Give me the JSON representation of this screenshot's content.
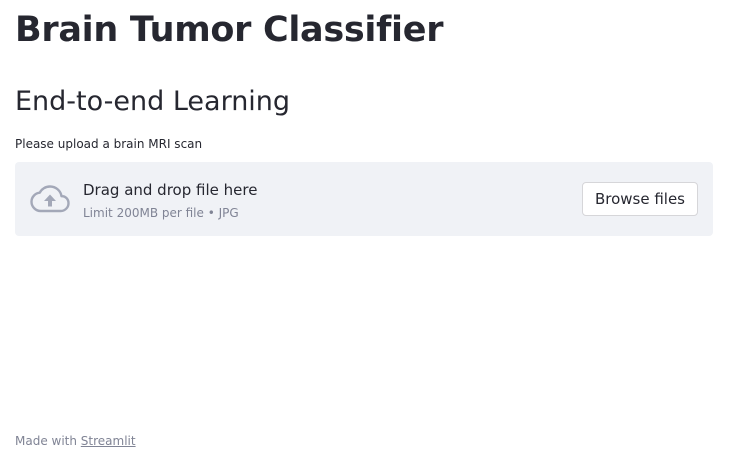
{
  "page": {
    "title": "Brain Tumor Classifier",
    "subtitle": "End-to-end Learning"
  },
  "uploader": {
    "label": "Please upload a brain MRI scan",
    "drop_text": "Drag and drop file here",
    "limit_text": "Limit 200MB per file • JPG",
    "browse_label": "Browse files",
    "icon": "cloud-upload-icon"
  },
  "footer": {
    "prefix": "Made with ",
    "link_text": "Streamlit"
  },
  "colors": {
    "text": "#262730",
    "muted": "#808495",
    "dropzone_bg": "#f0f2f6"
  }
}
